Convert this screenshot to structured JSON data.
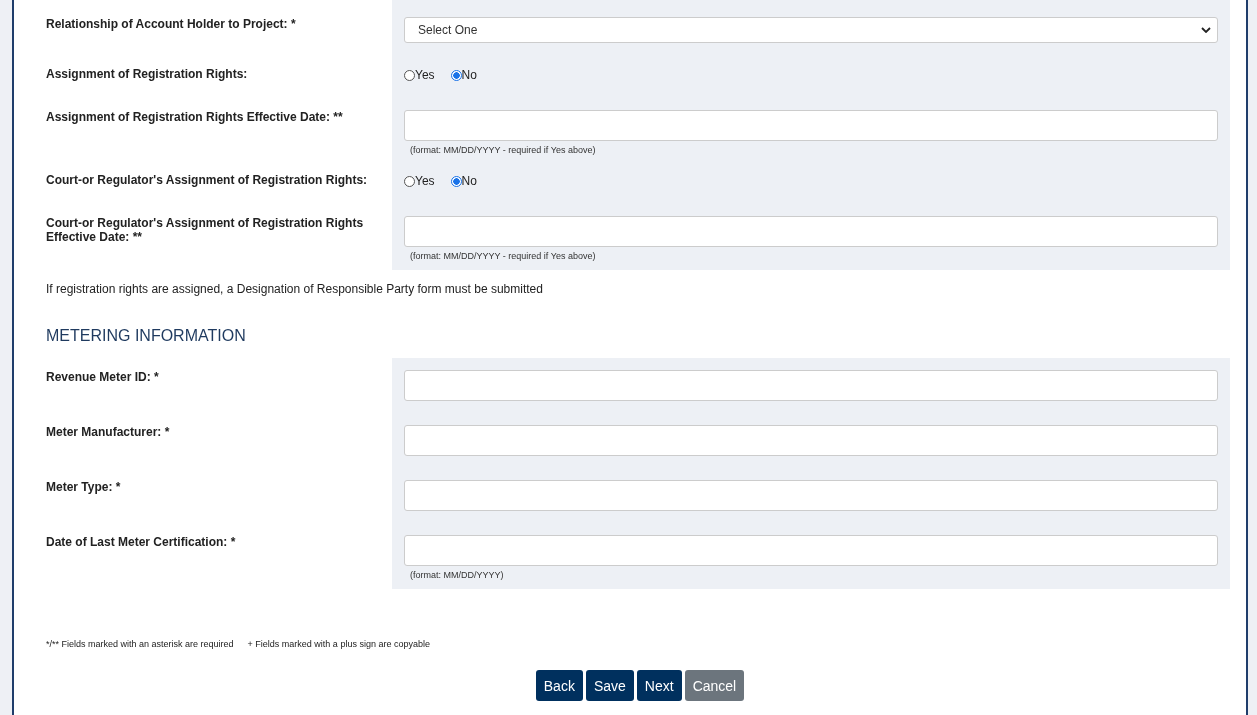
{
  "registration_rows": [
    {
      "kind": "select",
      "label": "Relationship of Account Holder to Project: *",
      "value": "Select One"
    },
    {
      "kind": "radio",
      "label": "Assignment of Registration Rights:",
      "options": [
        {
          "label": "Yes",
          "selected": false
        },
        {
          "label": "No",
          "selected": true
        }
      ]
    },
    {
      "kind": "text",
      "label": "Assignment of Registration Rights Effective Date: **",
      "hint": "(format: MM/DD/YYYY - required if Yes above)"
    },
    {
      "kind": "radio",
      "label": "Court-or Regulator's Assignment of Registration Rights:",
      "options": [
        {
          "label": "Yes",
          "selected": false
        },
        {
          "label": "No",
          "selected": true
        }
      ]
    },
    {
      "kind": "text",
      "label": "Court-or Regulator's Assignment of Registration Rights Effective Date: **",
      "hint": "(format: MM/DD/YYYY - required if Yes above)"
    }
  ],
  "assignment_note": "If registration rights are assigned, a Designation of Responsible Party form must be submitted",
  "metering_heading": "METERING INFORMATION",
  "metering_rows": [
    {
      "kind": "text",
      "label": "Revenue Meter ID: *"
    },
    {
      "kind": "text",
      "label": "Meter Manufacturer: *"
    },
    {
      "kind": "text",
      "label": "Meter Type: *"
    },
    {
      "kind": "text",
      "label": "Date of Last Meter Certification: *",
      "hint": "(format: MM/DD/YYYY)"
    }
  ],
  "footnotes": [
    "*/** Fields marked with an asterisk are required",
    "+ Fields marked with a plus sign are copyable"
  ],
  "buttons": [
    {
      "label": "Back",
      "kind": "primary"
    },
    {
      "label": "Save",
      "kind": "primary"
    },
    {
      "label": "Next",
      "kind": "primary"
    },
    {
      "label": "Cancel",
      "kind": "secondary"
    }
  ]
}
